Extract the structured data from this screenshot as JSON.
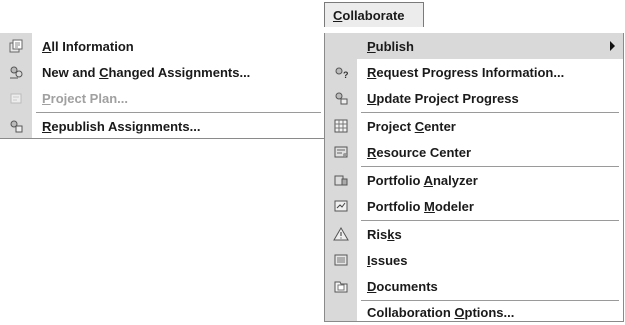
{
  "menubar": {
    "pre": "",
    "acc": "C",
    "post": "ollaborate"
  },
  "left_menu": {
    "items": [
      {
        "pre": "",
        "acc": "A",
        "post": "ll Information",
        "icon": "all-information-icon",
        "disabled": false
      },
      {
        "pre": "New and ",
        "acc": "C",
        "post": "hanged Assignments...",
        "icon": "new-changed-assignments-icon",
        "disabled": false
      },
      {
        "pre": "",
        "acc": "P",
        "post": "roject Plan...",
        "icon": "project-plan-icon",
        "disabled": true
      },
      {
        "pre": "",
        "acc": "R",
        "post": "epublish Assignments...",
        "icon": "republish-assignments-icon",
        "disabled": false
      }
    ]
  },
  "right_menu": {
    "items": [
      {
        "pre": "",
        "acc": "P",
        "post": "ublish",
        "icon": "none",
        "submenu": true,
        "highlight": true
      },
      {
        "pre": "",
        "acc": "R",
        "post": "equest Progress Information...",
        "icon": "request-progress-icon"
      },
      {
        "pre": "",
        "acc": "U",
        "post": "pdate Project Progress",
        "icon": "update-progress-icon"
      },
      {
        "pre": "Project ",
        "acc": "C",
        "post": "enter",
        "icon": "project-center-icon"
      },
      {
        "pre": "",
        "acc": "R",
        "post": "esource Center",
        "icon": "resource-center-icon"
      },
      {
        "pre": "Portfolio ",
        "acc": "A",
        "post": "nalyzer",
        "icon": "portfolio-analyzer-icon"
      },
      {
        "pre": "Portfolio ",
        "acc": "M",
        "post": "odeler",
        "icon": "portfolio-modeler-icon"
      },
      {
        "pre": "Ris",
        "acc": "k",
        "post": "s",
        "icon": "risks-icon"
      },
      {
        "pre": "",
        "acc": "I",
        "post": "ssues",
        "icon": "issues-icon"
      },
      {
        "pre": "",
        "acc": "D",
        "post": "ocuments",
        "icon": "documents-icon"
      },
      {
        "pre": "Collaboration ",
        "acc": "O",
        "post": "ptions...",
        "icon": "none"
      }
    ]
  }
}
